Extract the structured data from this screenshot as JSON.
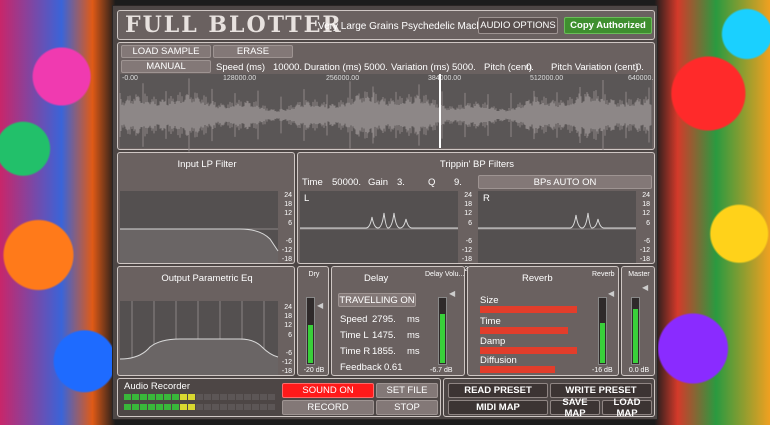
{
  "header": {
    "logo": "FULL BLOTTER",
    "subtitle": "Very Large Grains Psychedelic Machine",
    "audio_options": "AUDIO OPTIONS",
    "copy_authorized": "Copy Authorized"
  },
  "sample": {
    "load": "LOAD SAMPLE",
    "erase": "ERASE",
    "manual": "MANUAL",
    "speed_label": "Speed (ms)",
    "speed_value": "10000.",
    "duration_label": "Duration (ms)",
    "duration_value": "5000.",
    "variation_label": "Variation (ms)",
    "variation_value": "5000.",
    "pitch_label": "Pitch (cent)",
    "pitch_value": "0.",
    "pitch_var_label": "Pitch Variation (cent)",
    "pitch_var_value": "0.",
    "timeline": [
      "-0.00",
      "128000.00",
      "256000.00",
      "384000.00",
      "512000.00",
      "640000."
    ],
    "playhead_fraction": 0.6
  },
  "input_lp": {
    "title": "Input LP Filter"
  },
  "bp": {
    "title": "Trippin' BP Filters",
    "time_label": "Time",
    "time_value": "50000.",
    "gain_label": "Gain",
    "gain_value": "3.",
    "q_label": "Q",
    "q_value": "9.",
    "auto_button": "BPs AUTO ON",
    "left": "L",
    "right": "R"
  },
  "db_ticks": [
    "24",
    "18",
    "12",
    "6",
    "",
    "-6",
    "-12",
    "-18",
    "-24"
  ],
  "output_eq": {
    "title": "Output Parametric Eq"
  },
  "dry": {
    "label": "Dry",
    "value": "-20 dB",
    "level": 0.58
  },
  "delay": {
    "title": "Delay",
    "travelling": "TRAVELLING ON",
    "speed_label": "Speed",
    "speed_value": "2795.",
    "speed_unit": "ms",
    "timel_label": "Time L",
    "timel_value": "1475.",
    "timel_unit": "ms",
    "timer_label": "Time R",
    "timer_value": "1855.",
    "timer_unit": "ms",
    "feedback_label": "Feedback",
    "feedback_value": "0.61",
    "vol_label": "Delay Volu...",
    "vol_value": "-6.7 dB",
    "level": 0.75
  },
  "reverb": {
    "title": "Reverb",
    "size_label": "Size",
    "size_level": 0.97,
    "time_label": "Time",
    "time_level": 0.88,
    "damp_label": "Damp",
    "damp_level": 0.97,
    "diffusion_label": "Diffusion",
    "diffusion_level": 0.75,
    "vol_label": "Reverb",
    "vol_value": "-16 dB",
    "level": 0.6
  },
  "master": {
    "label": "Master",
    "value": "0.0 dB",
    "level": 0.82
  },
  "recorder": {
    "title": "Audio Recorder",
    "sound_on": "SOUND ON",
    "set_file": "SET FILE",
    "record": "RECORD",
    "stop": "STOP",
    "leds_lit_row1": 9,
    "leds_lit_row2": 9
  },
  "presets": {
    "read": "READ PRESET",
    "write": "WRITE PRESET",
    "midi": "MIDI MAP",
    "save": "SAVE MAP",
    "load": "LOAD MAP"
  },
  "colors": {
    "accent_green": "#39d03a",
    "accent_red": "#e23d2b",
    "copy_green": "#3f8f2f"
  }
}
